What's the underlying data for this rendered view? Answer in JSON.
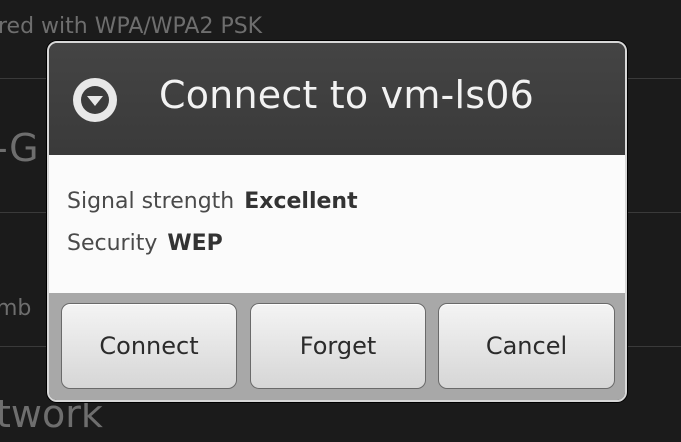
{
  "background": {
    "row1_text": "red with WPA/WPA2 PSK",
    "row2_text": "-G",
    "row3_text": "mb",
    "row4_text": "twork"
  },
  "dialog": {
    "title": "Connect to vm-ls06",
    "icon": "wifi-dropdown-icon",
    "info": {
      "signal_label": "Signal strength",
      "signal_value": "Excellent",
      "security_label": "Security",
      "security_value": "WEP"
    },
    "buttons": {
      "connect": "Connect",
      "forget": "Forget",
      "cancel": "Cancel"
    }
  },
  "colors": {
    "header_bg": "#3a3a3a",
    "body_bg": "#fbfbfb",
    "footer_bg": "#a8a8a8",
    "title_text": "#f2f2f2"
  }
}
